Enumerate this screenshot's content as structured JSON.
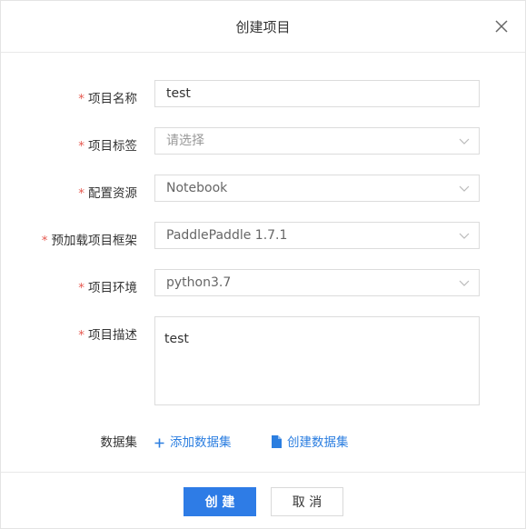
{
  "dialog": {
    "title": "创建项目",
    "close_icon": "close-icon"
  },
  "form": {
    "name": {
      "required_mark": "*",
      "label": "项目名称",
      "value": "test"
    },
    "tags": {
      "required_mark": "*",
      "label": "项目标签",
      "placeholder": "请选择"
    },
    "resource": {
      "required_mark": "*",
      "label": "配置资源",
      "value": "Notebook"
    },
    "framework": {
      "required_mark": "*",
      "label": "预加载项目框架",
      "value": "PaddlePaddle 1.7.1"
    },
    "environment": {
      "required_mark": "*",
      "label": "项目环境",
      "value": "python3.7"
    },
    "description": {
      "required_mark": "*",
      "label": "项目描述",
      "value": "test"
    }
  },
  "dataset": {
    "label": "数据集",
    "add_label": "添加数据集",
    "add_icon": "plus-icon",
    "create_label": "创建数据集",
    "create_icon": "file-icon"
  },
  "footer": {
    "confirm_label": "创 建",
    "cancel_label": "取 消"
  },
  "colors": {
    "accent": "#2e7ce6",
    "link": "#2b7ee0",
    "required": "#e5584f"
  }
}
